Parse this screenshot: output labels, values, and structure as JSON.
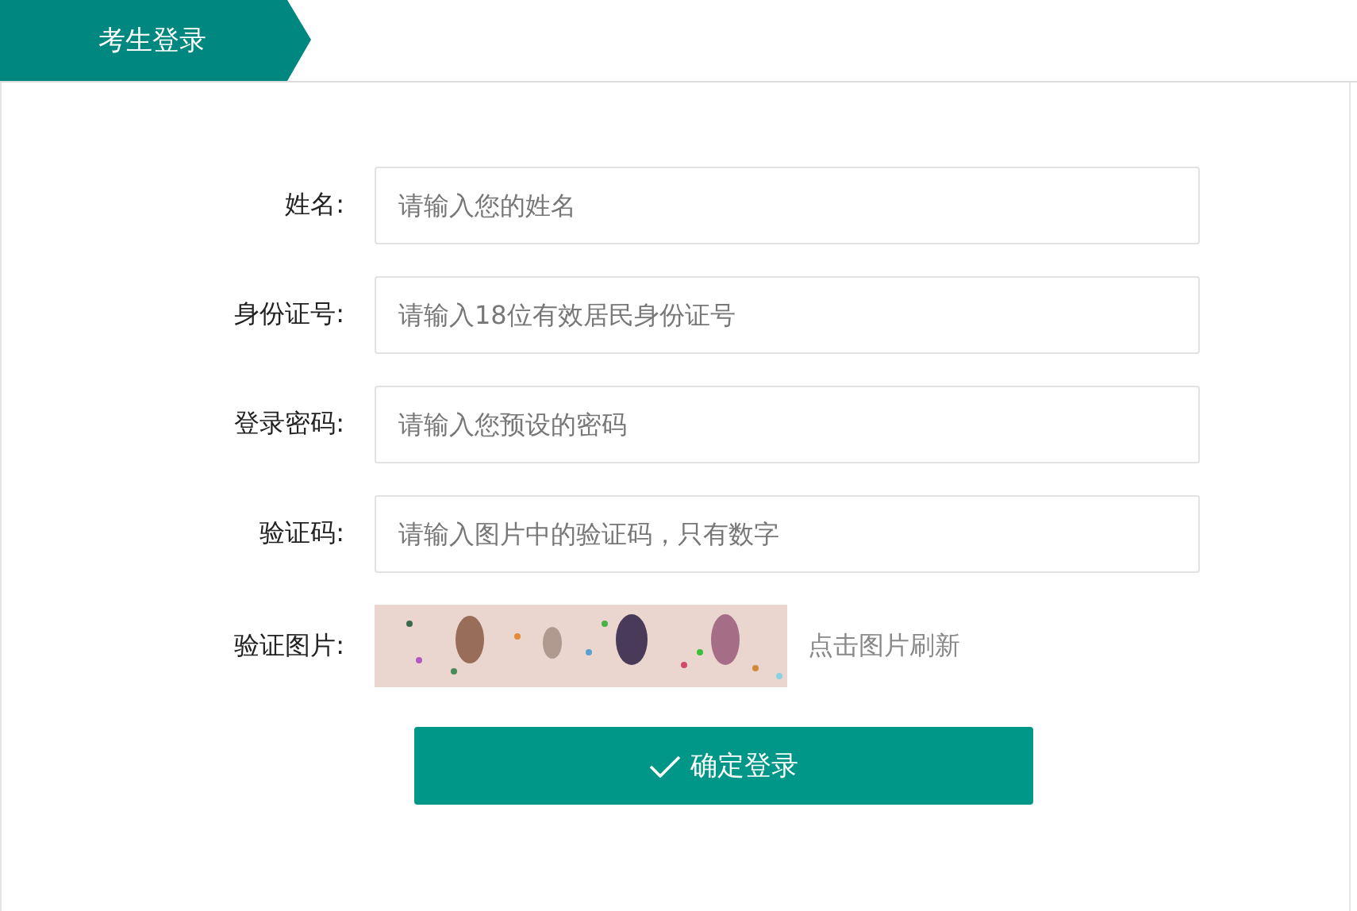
{
  "header": {
    "tab": "考生登录"
  },
  "fields": [
    {
      "label": "姓名:",
      "placeholder": "请输入您的姓名"
    },
    {
      "label": "身份证号:",
      "placeholder": "请输入18位有效居民身份证号"
    },
    {
      "label": "登录密码:",
      "placeholder": "请输入您预设的密码"
    },
    {
      "label": "验证码:",
      "placeholder": "请输入图片中的验证码，只有数字"
    }
  ],
  "captcha": {
    "label": "验证图片:",
    "hint": "点击图片刷新"
  },
  "submit": {
    "label": "确定登录"
  }
}
